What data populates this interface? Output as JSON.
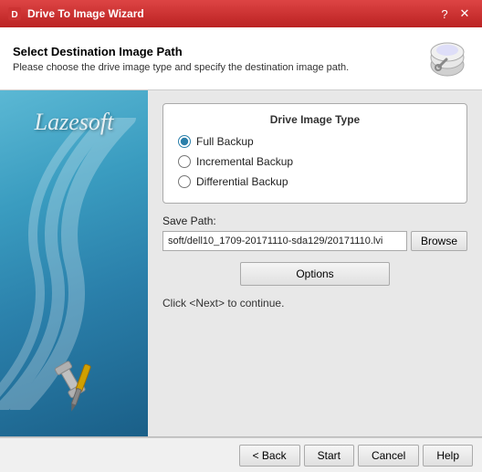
{
  "titleBar": {
    "title": "Drive To Image Wizard",
    "helpBtn": "?",
    "closeBtn": "✕"
  },
  "header": {
    "heading": "Select Destination Image Path",
    "subtext": "Please choose the drive image type and specify the destination image path."
  },
  "sidebar": {
    "logo": "Lazesoft"
  },
  "imageTypeBox": {
    "title": "Drive Image Type",
    "options": [
      {
        "label": "Full Backup",
        "checked": true,
        "id": "opt-full"
      },
      {
        "label": "Incremental Backup",
        "checked": false,
        "id": "opt-incremental"
      },
      {
        "label": "Differential Backup",
        "checked": false,
        "id": "opt-differential"
      }
    ]
  },
  "savePath": {
    "label": "Save Path:",
    "value": "soft/dell10_1709-20171110-sda129/20171110.lvi",
    "browseBtn": "Browse"
  },
  "optionsBtn": "Options",
  "hintText": "Click <Next> to continue.",
  "footer": {
    "backBtn": "< Back",
    "startBtn": "Start",
    "cancelBtn": "Cancel",
    "helpBtn": "Help"
  }
}
